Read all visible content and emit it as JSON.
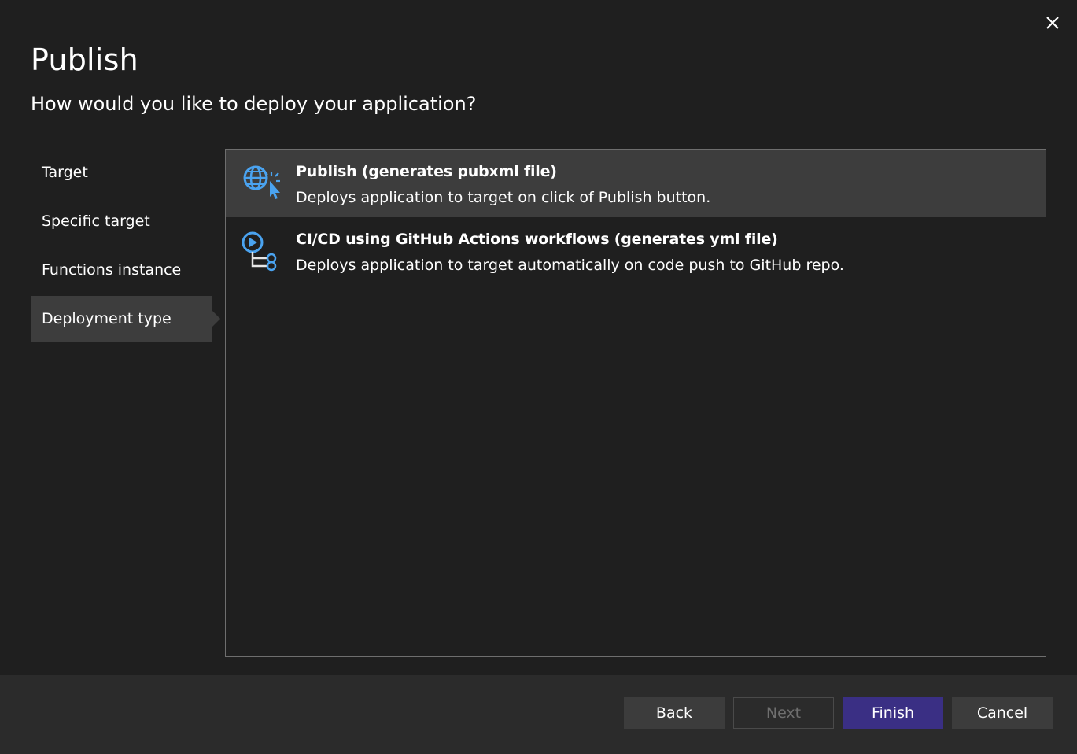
{
  "dialog": {
    "title": "Publish",
    "subtitle": "How would you like to deploy your application?"
  },
  "steps": [
    {
      "label": "Target"
    },
    {
      "label": "Specific target"
    },
    {
      "label": "Functions instance"
    },
    {
      "label": "Deployment type",
      "active": true
    }
  ],
  "options": [
    {
      "title": "Publish (generates pubxml file)",
      "description": "Deploys application to target on click of Publish button.",
      "icon": "globe-cursor-icon",
      "selected": true
    },
    {
      "title": "CI/CD using GitHub Actions workflows (generates yml file)",
      "description": "Deploys application to target automatically on code push to GitHub repo.",
      "icon": "workflow-icon",
      "selected": false
    }
  ],
  "footer": {
    "back_label": "Back",
    "next_label": "Next",
    "finish_label": "Finish",
    "cancel_label": "Cancel"
  },
  "colors": {
    "background": "#1f1f1f",
    "footer": "#2b2b2b",
    "selected": "#3d3d3d",
    "primary_button": "#3a2f84",
    "icon_accent": "#4aa3f0"
  }
}
